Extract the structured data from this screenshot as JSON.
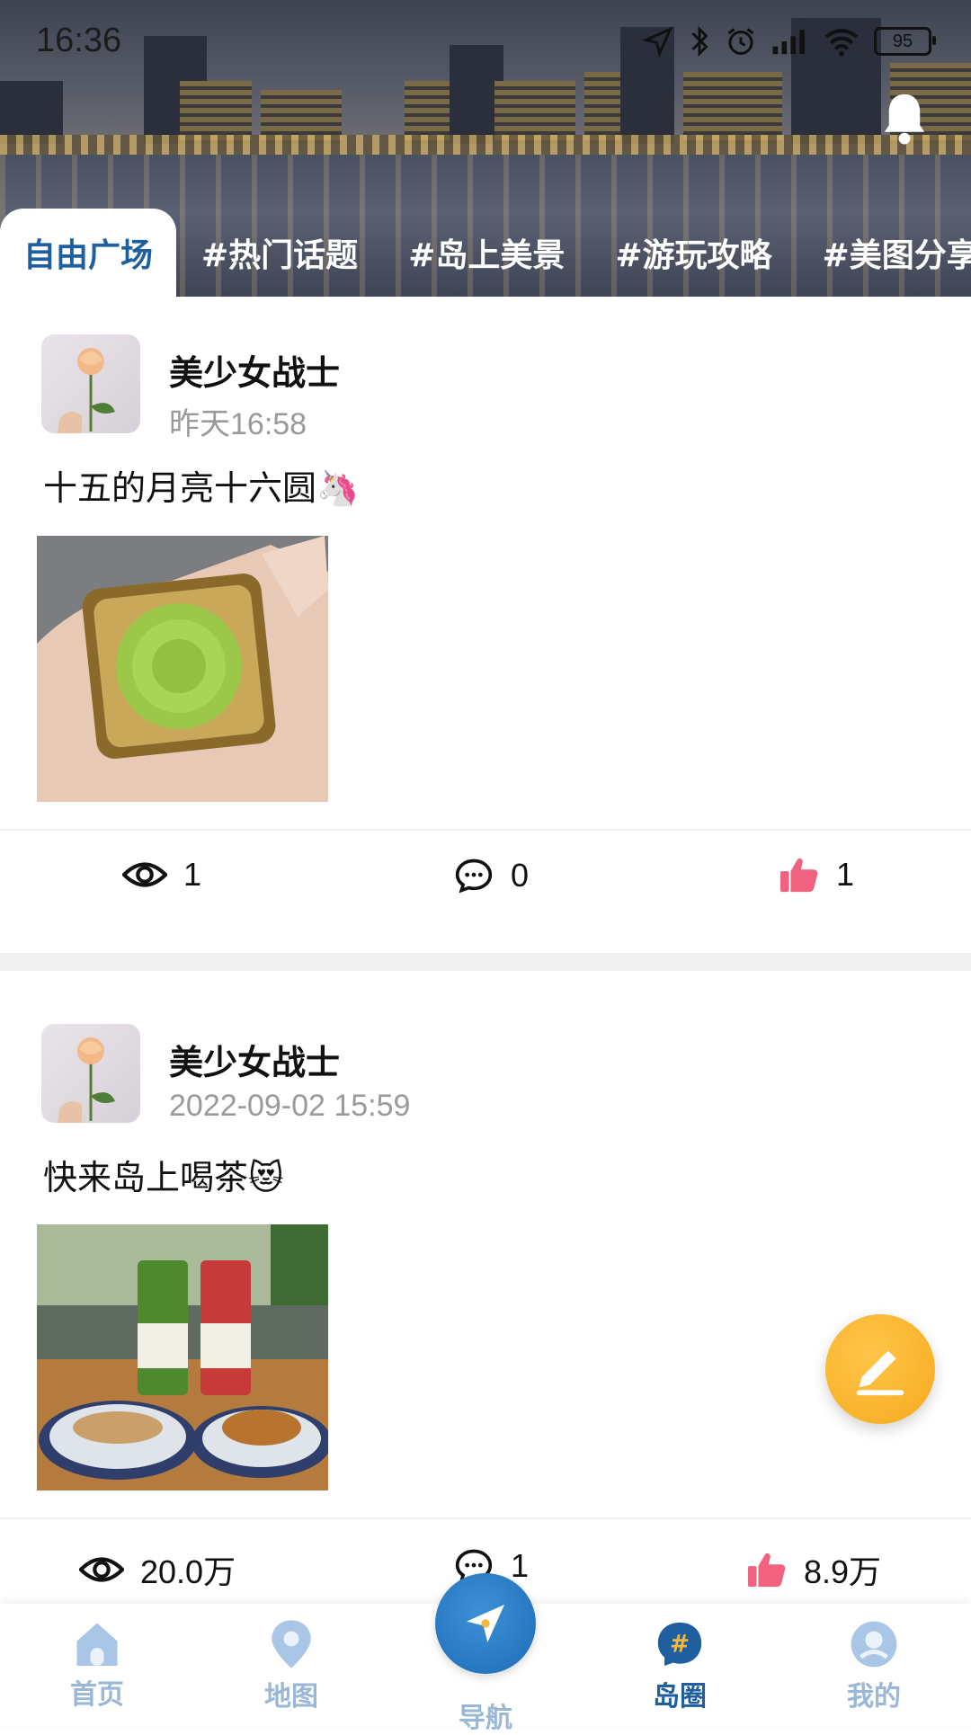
{
  "status_bar": {
    "time": "16:36",
    "battery": "95"
  },
  "tabs": [
    {
      "label": "自由广场",
      "active": true
    },
    {
      "label": "#热门话题"
    },
    {
      "label": "#岛上美景"
    },
    {
      "label": "#游玩攻略"
    },
    {
      "label": "#美图分享"
    }
  ],
  "posts": [
    {
      "author": "美少女战士",
      "time": "昨天16:58",
      "text": "十五的月亮十六圆🦄",
      "views": "1",
      "comments": "0",
      "likes": "1"
    },
    {
      "author": "美少女战士",
      "time": "2022-09-02 15:59",
      "text": "快来岛上喝茶😻",
      "views": "20.0万",
      "comments": "1",
      "likes": "8.9万"
    }
  ],
  "nav": {
    "home": "首页",
    "map": "地图",
    "navigate": "导航",
    "circle": "岛圈",
    "mine": "我的"
  },
  "colors": {
    "accent": "#1f5fa0",
    "like": "#f0627f",
    "fab": "#f6a91d"
  }
}
